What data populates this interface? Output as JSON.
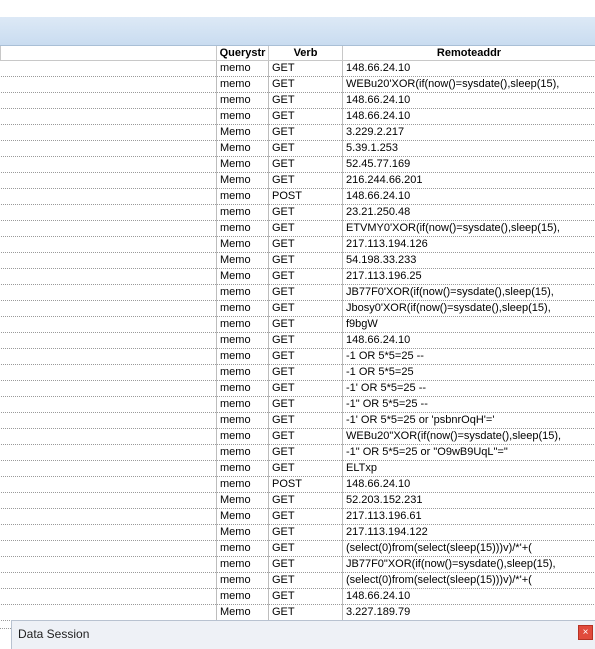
{
  "grid": {
    "columns": [
      "",
      "Querystr",
      "Verb",
      "Remoteaddr"
    ],
    "rows": [
      [
        "memo",
        "GET",
        "148.66.24.10"
      ],
      [
        "memo",
        "GET",
        "WEBu20'XOR(if(now()=sysdate(),sleep(15),"
      ],
      [
        "memo",
        "GET",
        "148.66.24.10"
      ],
      [
        "memo",
        "GET",
        "148.66.24.10"
      ],
      [
        "Memo",
        "GET",
        "3.229.2.217"
      ],
      [
        "Memo",
        "GET",
        "5.39.1.253"
      ],
      [
        "Memo",
        "GET",
        "52.45.77.169"
      ],
      [
        "Memo",
        "GET",
        "216.244.66.201"
      ],
      [
        "memo",
        "POST",
        "148.66.24.10"
      ],
      [
        "memo",
        "GET",
        "23.21.250.48"
      ],
      [
        "memo",
        "GET",
        "ETVMY0'XOR(if(now()=sysdate(),sleep(15),"
      ],
      [
        "Memo",
        "GET",
        "217.113.194.126"
      ],
      [
        "Memo",
        "GET",
        "54.198.33.233"
      ],
      [
        "Memo",
        "GET",
        "217.113.196.25"
      ],
      [
        "memo",
        "GET",
        "JB77F0'XOR(if(now()=sysdate(),sleep(15),"
      ],
      [
        "memo",
        "GET",
        "Jbosy0'XOR(if(now()=sysdate(),sleep(15),"
      ],
      [
        "memo",
        "GET",
        "f9bgW"
      ],
      [
        "memo",
        "GET",
        "148.66.24.10"
      ],
      [
        "memo",
        "GET",
        "-1 OR 5*5=25 --"
      ],
      [
        "memo",
        "GET",
        "-1 OR 5*5=25"
      ],
      [
        "memo",
        "GET",
        "-1' OR 5*5=25 --"
      ],
      [
        "memo",
        "GET",
        "-1\" OR 5*5=25 --"
      ],
      [
        "memo",
        "GET",
        "-1' OR 5*5=25 or 'psbnrOqH'='"
      ],
      [
        "memo",
        "GET",
        "WEBu20\"XOR(if(now()=sysdate(),sleep(15),"
      ],
      [
        "memo",
        "GET",
        "-1\" OR 5*5=25 or \"O9wB9UqL\"=\""
      ],
      [
        "memo",
        "GET",
        "ELTxp"
      ],
      [
        "memo",
        "POST",
        "148.66.24.10"
      ],
      [
        "Memo",
        "GET",
        "52.203.152.231"
      ],
      [
        "Memo",
        "GET",
        "217.113.196.61"
      ],
      [
        "Memo",
        "GET",
        "217.113.194.122"
      ],
      [
        "memo",
        "GET",
        "(select(0)from(select(sleep(15)))v)/*'+("
      ],
      [
        "memo",
        "GET",
        "JB77F0\"XOR(if(now()=sysdate(),sleep(15),"
      ],
      [
        "memo",
        "GET",
        "(select(0)from(select(sleep(15)))v)/*'+("
      ],
      [
        "memo",
        "GET",
        "148.66.24.10"
      ],
      [
        "Memo",
        "GET",
        "3.227.189.79"
      ]
    ]
  },
  "bottom_panel": {
    "title": "Data Session",
    "close_glyph": "×"
  }
}
